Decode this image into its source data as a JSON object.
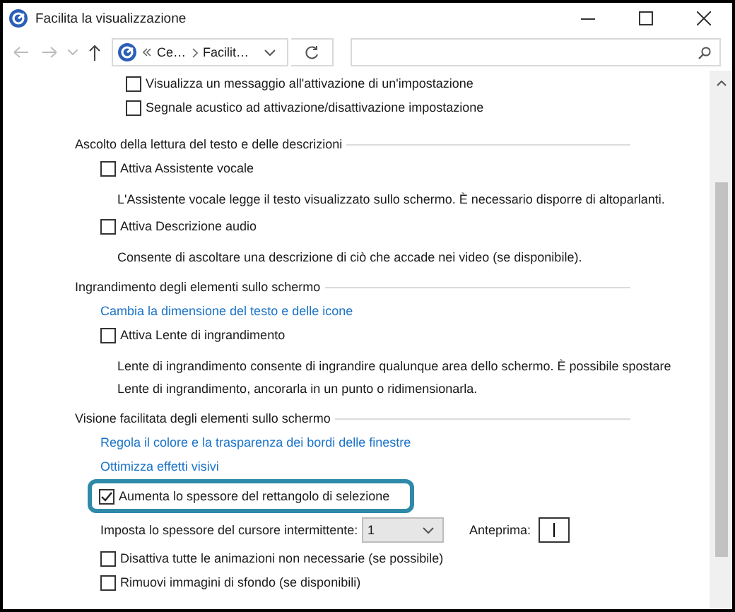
{
  "window": {
    "title": "Facilita la visualizzazione"
  },
  "address_bar": {
    "segments": [
      "Ce…",
      "Facilit…"
    ]
  },
  "top_options": [
    {
      "label": "Visualizza un messaggio all'attivazione di un'impostazione",
      "checked": false
    },
    {
      "label": "Segnale acustico ad attivazione/disattivazione impostazione",
      "checked": false
    }
  ],
  "sections": [
    {
      "title": "Ascolto della lettura del testo e delle descrizioni",
      "items": [
        {
          "kind": "checkbox",
          "label": "Attiva Assistente vocale",
          "checked": false,
          "description": "L'Assistente vocale legge il testo visualizzato sullo schermo. È necessario disporre di altoparlanti."
        },
        {
          "kind": "checkbox",
          "label": "Attiva Descrizione audio",
          "checked": false,
          "description": "Consente di ascoltare una descrizione di ciò che accade nei video (se disponibile)."
        }
      ]
    },
    {
      "title": "Ingrandimento degli elementi sullo schermo",
      "items": [
        {
          "kind": "link",
          "label": "Cambia la dimensione del testo e delle icone"
        },
        {
          "kind": "checkbox",
          "label": "Attiva Lente di ingrandimento",
          "checked": false,
          "description": "Lente di ingrandimento consente di ingrandire qualunque area dello schermo. È possibile spostare Lente di ingrandimento, ancorarla in un punto o ridimensionarla."
        }
      ]
    },
    {
      "title": "Visione facilitata degli elementi sullo schermo",
      "items": [
        {
          "kind": "link",
          "label": "Regola il colore e la trasparenza dei bordi delle finestre"
        },
        {
          "kind": "link",
          "label": "Ottimizza effetti visivi"
        },
        {
          "kind": "checkbox",
          "label": "Aumenta lo spessore del rettangolo di selezione",
          "checked": true,
          "highlighted": true
        },
        {
          "kind": "select",
          "label": "Imposta lo spessore del cursore intermittente:",
          "value": "1",
          "preview_label": "Anteprima:"
        },
        {
          "kind": "checkbox",
          "label": "Disattiva tutte le animazioni non necessarie (se possibile)",
          "checked": false
        },
        {
          "kind": "checkbox",
          "label": "Rimuovi immagini di sfondo (se disponibili)",
          "checked": false
        }
      ]
    }
  ]
}
